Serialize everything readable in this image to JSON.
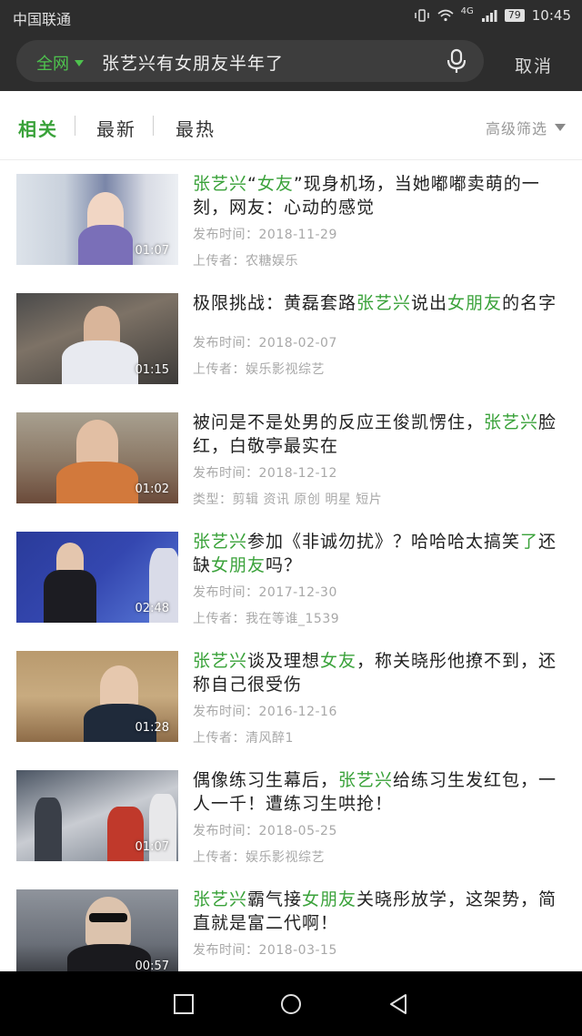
{
  "status_bar": {
    "carrier": "中国联通",
    "network": "4G",
    "battery": "79",
    "time": "10:45"
  },
  "search": {
    "scope_label": "全网",
    "query": "张艺兴有女朋友半年了",
    "cancel_label": "取消",
    "mic_icon": "microphone-icon"
  },
  "tabs": {
    "items": [
      {
        "label": "相关"
      },
      {
        "label": "最新"
      },
      {
        "label": "最热"
      }
    ],
    "filter_label": "高级筛选"
  },
  "colors": {
    "accent": "#3aa23a",
    "header_bg": "#2d2d2d",
    "meta_text": "#a8a8a8"
  },
  "results": [
    {
      "title_parts": [
        {
          "text": "张艺兴",
          "hl": true
        },
        {
          "text": "“",
          "hl": false
        },
        {
          "text": "女友",
          "hl": true
        },
        {
          "text": "”现身机场，当她嘟嘟卖萌的一刻，网友：心动的感觉",
          "hl": false
        }
      ],
      "duration": "01:07",
      "meta1": "发布时间：2018-11-29",
      "meta2": "上传者：农糖娱乐"
    },
    {
      "title_parts": [
        {
          "text": "极限挑战：黄磊套路",
          "hl": false
        },
        {
          "text": "张艺兴",
          "hl": true
        },
        {
          "text": "说出",
          "hl": false
        },
        {
          "text": "女朋友",
          "hl": true
        },
        {
          "text": "的名字",
          "hl": false
        }
      ],
      "duration": "01:15",
      "meta1": "发布时间：2018-02-07",
      "meta2": "上传者：娱乐影视综艺"
    },
    {
      "title_parts": [
        {
          "text": "被问是不是处男的反应王俊凯愣住，",
          "hl": false
        },
        {
          "text": "张艺兴",
          "hl": true
        },
        {
          "text": "脸红，白敬亭最实在",
          "hl": false
        }
      ],
      "duration": "01:02",
      "meta1": "发布时间：2018-12-12",
      "meta2": "类型：剪辑 资讯 原创 明星 短片"
    },
    {
      "title_parts": [
        {
          "text": "张艺兴",
          "hl": true
        },
        {
          "text": "参加《非诚勿扰》？哈哈哈太搞笑",
          "hl": false
        },
        {
          "text": "了",
          "hl": true
        },
        {
          "text": "还缺",
          "hl": false
        },
        {
          "text": "女朋友",
          "hl": true
        },
        {
          "text": "吗？",
          "hl": false
        }
      ],
      "duration": "02:48",
      "meta1": "发布时间：2017-12-30",
      "meta2": "上传者：我在等谁_1539"
    },
    {
      "title_parts": [
        {
          "text": "张艺兴",
          "hl": true
        },
        {
          "text": "谈及理想",
          "hl": false
        },
        {
          "text": "女友",
          "hl": true
        },
        {
          "text": "，称关晓彤他撩不到，还称自己很受伤",
          "hl": false
        }
      ],
      "duration": "01:28",
      "meta1": "发布时间：2016-12-16",
      "meta2": "上传者：清风醉1"
    },
    {
      "title_parts": [
        {
          "text": "偶像练习生幕后，",
          "hl": false
        },
        {
          "text": "张艺兴",
          "hl": true
        },
        {
          "text": "给练习生发红包，一人一千！遭练习生哄抢！",
          "hl": false
        }
      ],
      "duration": "01:07",
      "meta1": "发布时间：2018-05-25",
      "meta2": "上传者：娱乐影视综艺"
    },
    {
      "title_parts": [
        {
          "text": "张艺兴",
          "hl": true
        },
        {
          "text": "霸气接",
          "hl": false
        },
        {
          "text": "女朋友",
          "hl": true
        },
        {
          "text": "关晓彤放学，这架势，简直就是富二代啊！",
          "hl": false
        }
      ],
      "duration": "00:57",
      "meta1": "发布时间：2018-03-15",
      "meta2": ""
    }
  ]
}
